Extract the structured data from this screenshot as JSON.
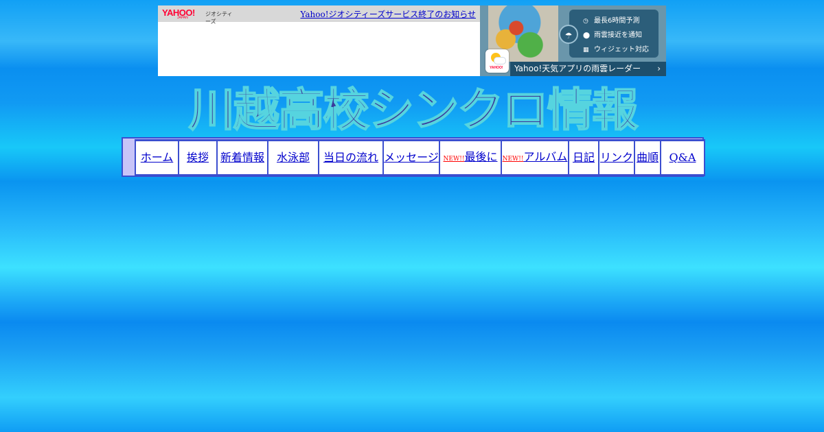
{
  "banner": {
    "logo_word": "YAHOO!",
    "logo_sub": "JAPAN",
    "logo_service": "ジオシティーズ",
    "notice_link": "Yahoo!ジオシティーズサービス終了のお知らせ",
    "weather_ad": {
      "features": [
        {
          "icon": "clock-icon",
          "label": "最長6時間予測"
        },
        {
          "icon": "location-pin-icon",
          "label": "雨雲接近を通知"
        },
        {
          "icon": "widget-icon",
          "label": "ウィジェット対応"
        }
      ],
      "cta": "Yahoo!天気アプリの雨雲レーダー",
      "app_icon_label": "YAHOO!"
    }
  },
  "site_title": "川越高校シンクロ情報",
  "nav": {
    "new_badge": "NEW!!",
    "items": [
      {
        "label": "ホーム",
        "is_new": false
      },
      {
        "label": "挨拶",
        "is_new": false
      },
      {
        "label": "新着情報",
        "is_new": false
      },
      {
        "label": "水泳部",
        "is_new": false
      },
      {
        "label": "当日の流れ",
        "is_new": false
      },
      {
        "label": "メッセージ",
        "is_new": false
      },
      {
        "label": "最後に",
        "is_new": true
      },
      {
        "label": "アルバム",
        "is_new": true
      },
      {
        "label": "日記",
        "is_new": false
      },
      {
        "label": "リンク",
        "is_new": false
      },
      {
        "label": "曲順",
        "is_new": false
      },
      {
        "label": "Q&A",
        "is_new": false
      }
    ]
  },
  "colors": {
    "background": "#11a0f5",
    "nav_border": "#3b4ecf",
    "nav_frame": "#c8c4f8",
    "link": "#0000cc",
    "new_badge": "#ff0000",
    "title_fill": "#3a3a9c",
    "title_outline": "#56d4df"
  }
}
